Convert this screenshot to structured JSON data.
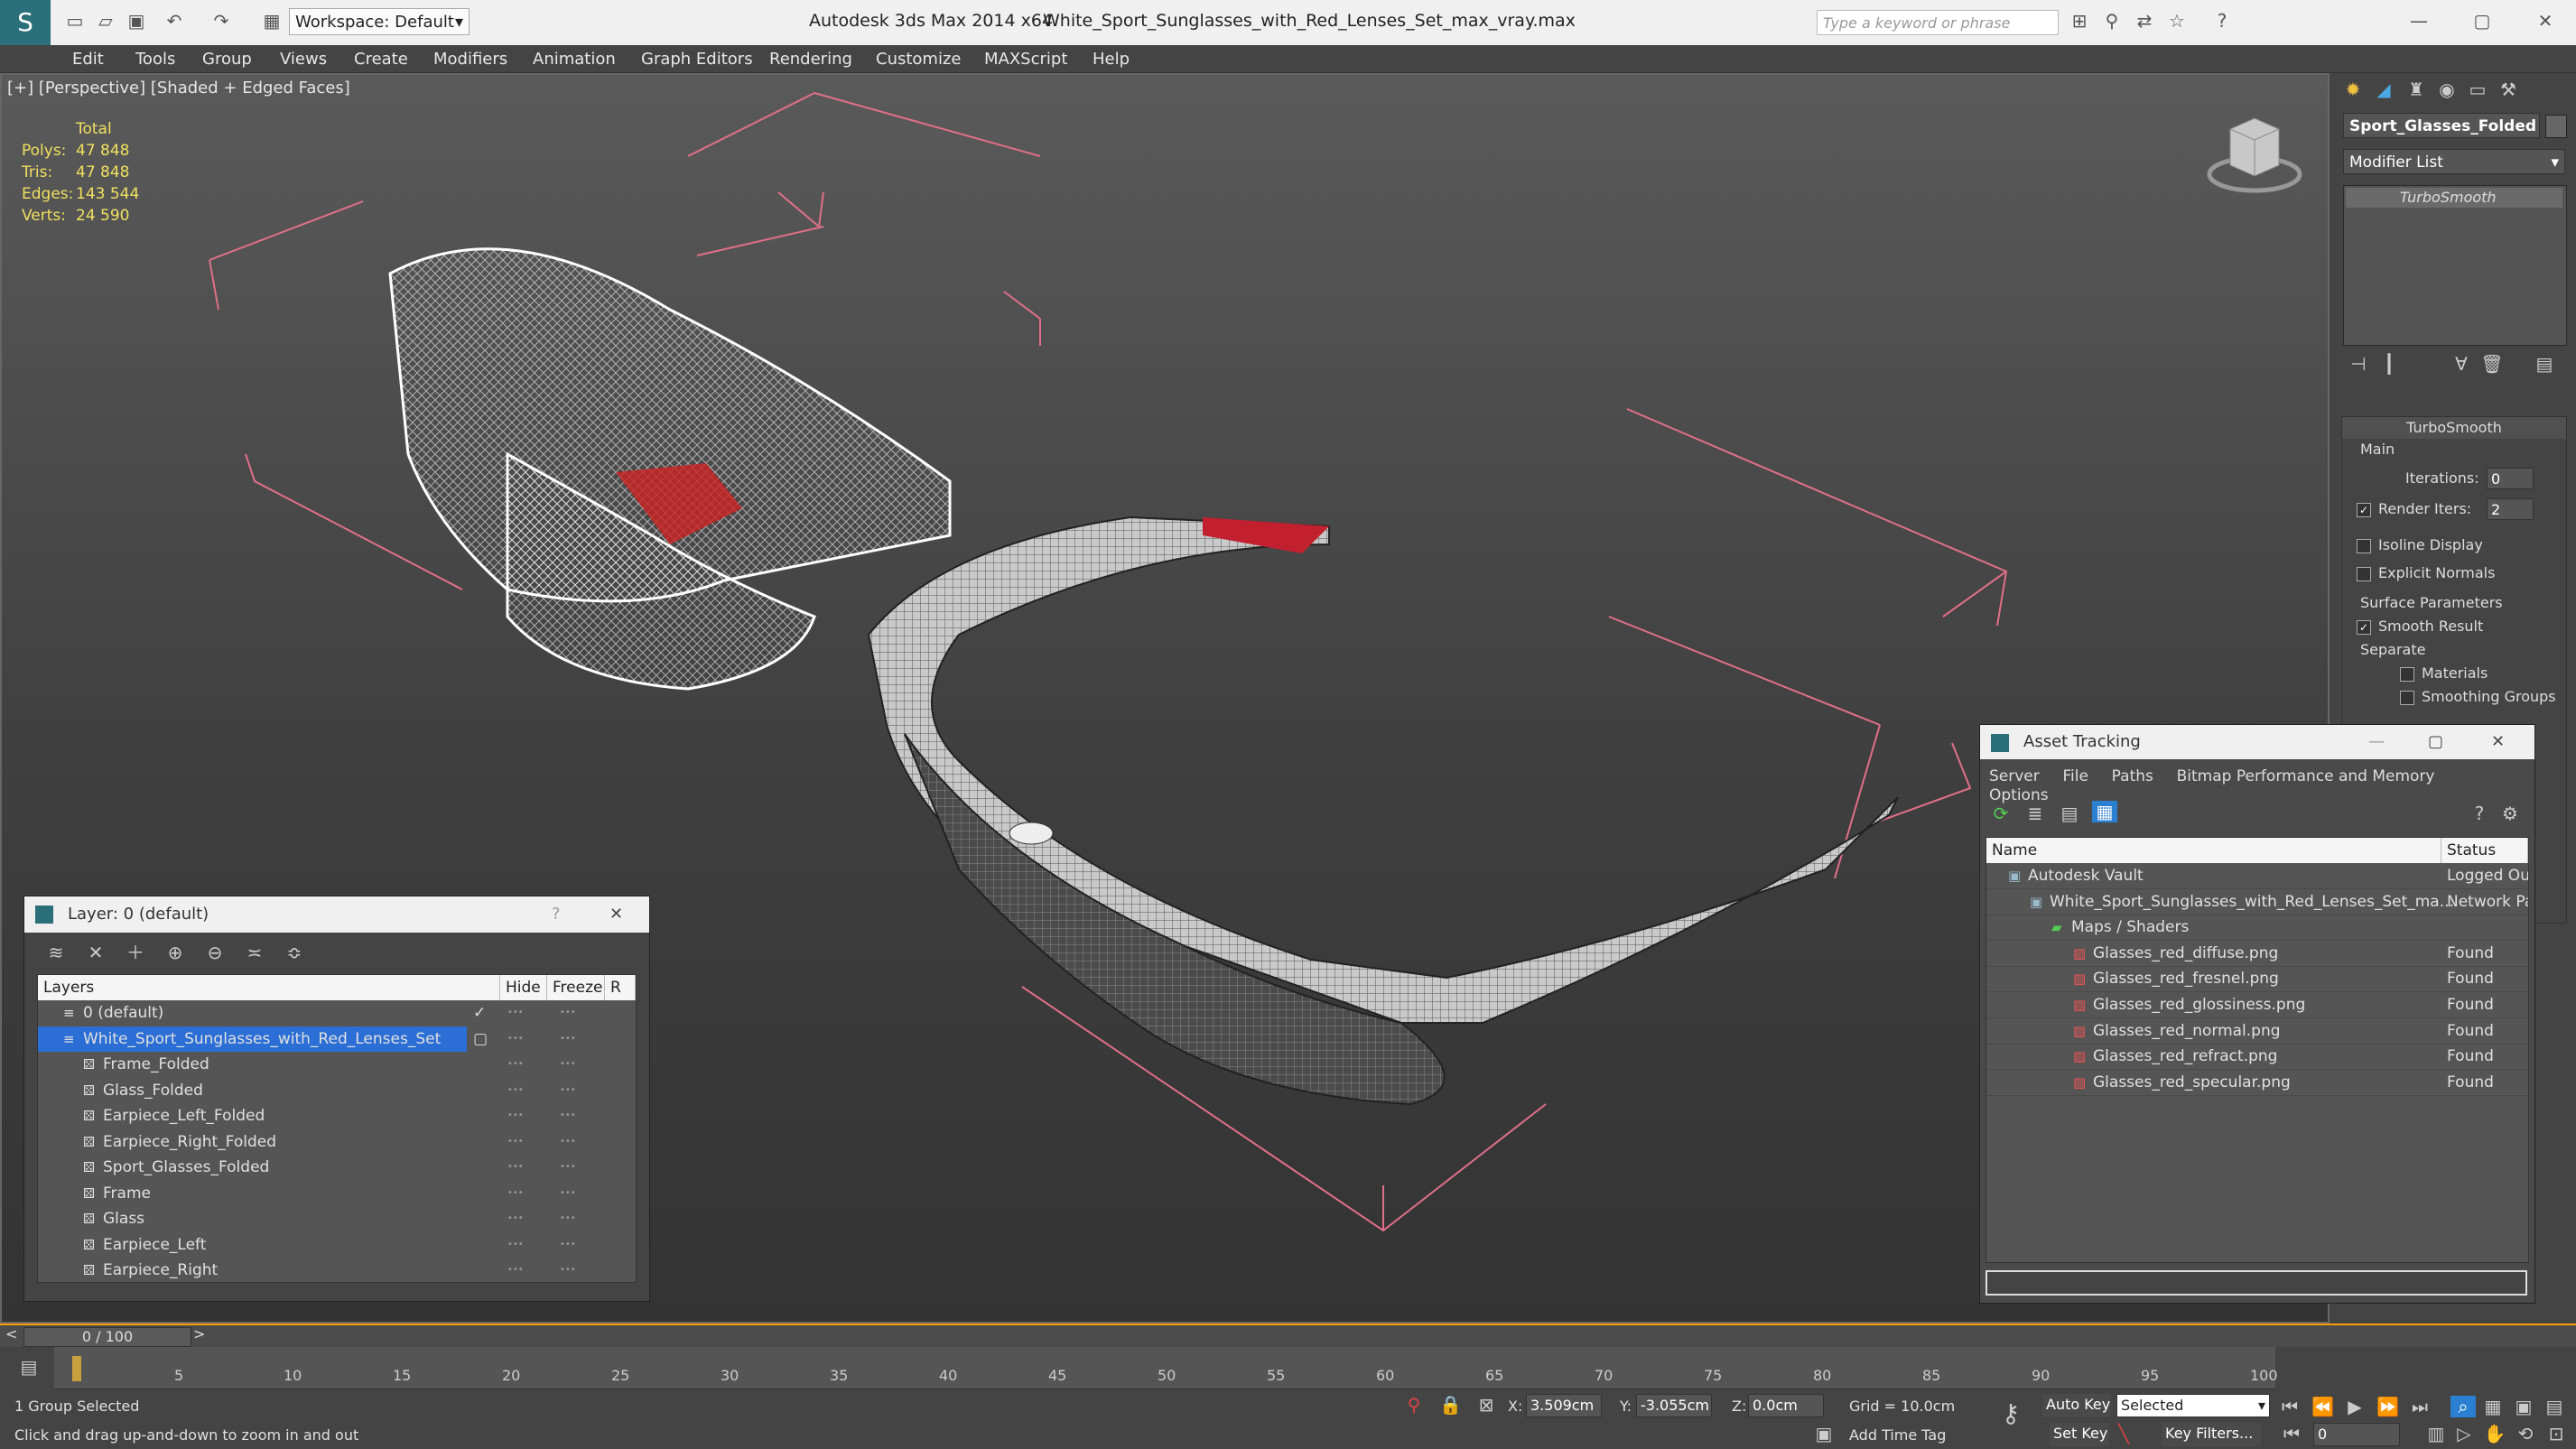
{
  "title_bar": {
    "app_title": "Autodesk 3ds Max  2014 x64",
    "file_name": "White_Sport_Sunglasses_with_Red_Lenses_Set_max_vray.max",
    "workspace": "Workspace: Default",
    "search_placeholder": "Type a keyword or phrase"
  },
  "menu": [
    "Edit",
    "Tools",
    "Group",
    "Views",
    "Create",
    "Modifiers",
    "Animation",
    "Graph Editors",
    "Rendering",
    "Customize",
    "MAXScript",
    "Help"
  ],
  "viewport": {
    "label": "[+] [Perspective] [Shaded + Edged Faces]",
    "stats": {
      "header": "Total",
      "polys_label": "Polys:",
      "polys": "47 848",
      "tris_label": "Tris:",
      "tris": "47 848",
      "edges_label": "Edges:",
      "edges": "143 544",
      "verts_label": "Verts:",
      "verts": "24 590"
    }
  },
  "command_panel": {
    "object_name": "Sport_Glasses_Folded",
    "modifier_list": "Modifier List",
    "stack_item": "TurboSmooth",
    "rollout_title": "TurboSmooth",
    "main_label": "Main",
    "iterations_label": "Iterations:",
    "iterations": "0",
    "render_iters_label": "Render Iters:",
    "render_iters": "2",
    "isoline": "Isoline Display",
    "explicit_normals": "Explicit Normals",
    "surface_params": "Surface Parameters",
    "smooth_result": "Smooth Result",
    "separate": "Separate",
    "materials": "Materials",
    "smoothing_groups": "Smoothing Groups"
  },
  "layer_panel": {
    "title": "Layer: 0 (default)",
    "help": "?",
    "col_layers": "Layers",
    "col_hide": "Hide",
    "col_freeze": "Freeze",
    "col_r": "R",
    "rows": [
      {
        "name": "0 (default)",
        "indent": 0
      },
      {
        "name": "White_Sport_Sunglasses_with_Red_Lenses_Set",
        "indent": 0
      },
      {
        "name": "Frame_Folded",
        "indent": 1
      },
      {
        "name": "Glass_Folded",
        "indent": 1
      },
      {
        "name": "Earpiece_Left_Folded",
        "indent": 1
      },
      {
        "name": "Earpiece_Right_Folded",
        "indent": 1
      },
      {
        "name": "Sport_Glasses_Folded",
        "indent": 1
      },
      {
        "name": "Frame",
        "indent": 1
      },
      {
        "name": "Glass",
        "indent": 1
      },
      {
        "name": "Earpiece_Left",
        "indent": 1
      },
      {
        "name": "Earpiece_Right",
        "indent": 1
      }
    ]
  },
  "asset_tracking": {
    "title": "Asset Tracking",
    "menu": [
      "Server",
      "File",
      "Paths",
      "Bitmap Performance and Memory",
      "Options"
    ],
    "col_name": "Name",
    "col_status": "Status",
    "rows": [
      {
        "name": "Autodesk Vault",
        "status": "Logged Ou",
        "indent": 1
      },
      {
        "name": "White_Sport_Sunglasses_with_Red_Lenses_Set_ma...",
        "status": "Network Pa",
        "indent": 2
      },
      {
        "name": "Maps / Shaders",
        "status": "",
        "indent": 3
      },
      {
        "name": "Glasses_red_diffuse.png",
        "status": "Found",
        "indent": 4
      },
      {
        "name": "Glasses_red_fresnel.png",
        "status": "Found",
        "indent": 4
      },
      {
        "name": "Glasses_red_glossiness.png",
        "status": "Found",
        "indent": 4
      },
      {
        "name": "Glasses_red_normal.png",
        "status": "Found",
        "indent": 4
      },
      {
        "name": "Glasses_red_refract.png",
        "status": "Found",
        "indent": 4
      },
      {
        "name": "Glasses_red_specular.png",
        "status": "Found",
        "indent": 4
      }
    ]
  },
  "timeline": {
    "frame": "0 / 100",
    "ticks": [
      "5",
      "10",
      "15",
      "20",
      "25",
      "30",
      "35",
      "40",
      "45",
      "50",
      "55",
      "60",
      "65",
      "70",
      "75",
      "80",
      "85",
      "90",
      "95",
      "100"
    ]
  },
  "status": {
    "selection": "1 Group Selected",
    "prompt": "Click and drag up-and-down to zoom in and out",
    "x_label": "X:",
    "x": "3.509cm",
    "y_label": "Y:",
    "y": "-3.055cm",
    "z_label": "Z:",
    "z": "0.0cm",
    "grid": "Grid = 10.0cm",
    "add_time_tag": "Add Time Tag",
    "auto_key": "Auto Key",
    "set_key": "Set Key",
    "selected": "Selected",
    "key_filters": "Key Filters...",
    "frame_field": "0"
  }
}
